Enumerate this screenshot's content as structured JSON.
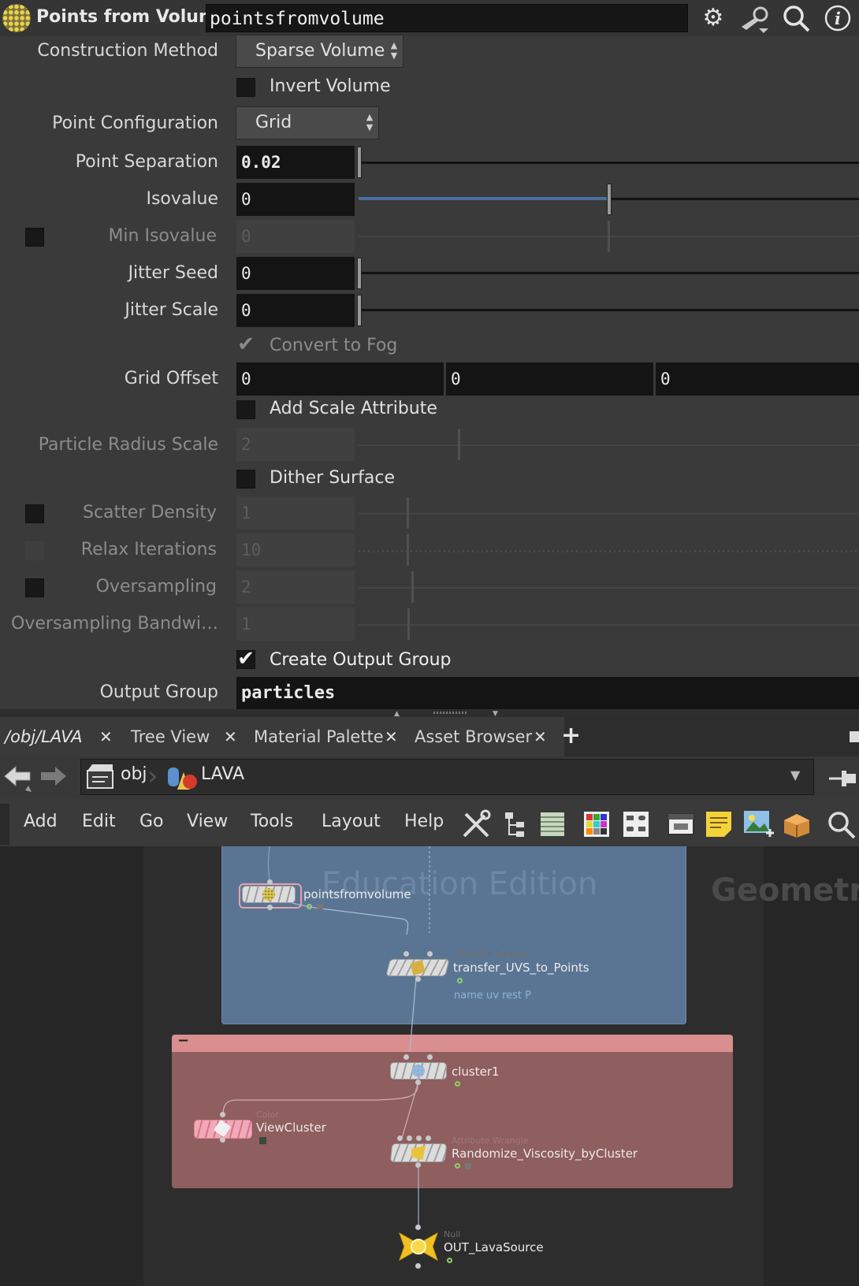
{
  "header": {
    "node_type_title": "Points from Volume",
    "node_name": "pointsfromvolume"
  },
  "params": {
    "construction_method": {
      "label": "Construction Method",
      "value": "Sparse Volume"
    },
    "invert_volume": {
      "label": "Invert Volume",
      "checked": false
    },
    "point_configuration": {
      "label": "Point Configuration",
      "value": "Grid"
    },
    "point_separation": {
      "label": "Point Separation",
      "value": "0.02"
    },
    "isovalue": {
      "label": "Isovalue",
      "value": "0"
    },
    "min_isovalue": {
      "label": "Min Isovalue",
      "value": "0"
    },
    "jitter_seed": {
      "label": "Jitter Seed",
      "value": "0"
    },
    "jitter_scale": {
      "label": "Jitter Scale",
      "value": "0"
    },
    "convert_to_fog": {
      "label": "Convert to Fog",
      "checked": true
    },
    "grid_offset": {
      "label": "Grid Offset",
      "x": "0",
      "y": "0",
      "z": "0"
    },
    "add_scale_attribute": {
      "label": "Add Scale Attribute",
      "checked": false
    },
    "particle_radius_scale": {
      "label": "Particle Radius Scale",
      "value": "2"
    },
    "dither_surface": {
      "label": "Dither Surface",
      "checked": false
    },
    "scatter_density": {
      "label": "Scatter Density",
      "value": "1"
    },
    "relax_iterations": {
      "label": "Relax Iterations",
      "value": "10"
    },
    "oversampling": {
      "label": "Oversampling",
      "value": "2"
    },
    "oversampling_bandwidth": {
      "label": "Oversampling Bandwi…",
      "value": "1"
    },
    "create_output_group": {
      "label": "Create Output Group",
      "checked": true
    },
    "output_group": {
      "label": "Output Group",
      "value": "particles"
    }
  },
  "tabs": [
    {
      "label": "/obj/LAVA",
      "active": true
    },
    {
      "label": "Tree View"
    },
    {
      "label": "Material Palette"
    },
    {
      "label": "Asset Browser"
    }
  ],
  "path": {
    "segments": [
      "obj",
      "LAVA"
    ]
  },
  "menu": [
    "Add",
    "Edit",
    "Go",
    "View",
    "Tools",
    "Layout",
    "Help"
  ],
  "network": {
    "watermark": "Education Edition",
    "context_label": "Geometr",
    "nodes": {
      "pointsfromvolume": {
        "name": "pointsfromvolume"
      },
      "transfer": {
        "type": "Attribute Transfer",
        "name": "transfer_UVS_to_Points",
        "note": "name uv rest P"
      },
      "cluster": {
        "name": "cluster1"
      },
      "viewcluster": {
        "type": "Color",
        "name": "ViewCluster"
      },
      "randomize": {
        "type": "Attribute Wrangle",
        "name": "Randomize_Viscosity_byCluster"
      },
      "out": {
        "type": "Null",
        "name": "OUT_LavaSource"
      }
    },
    "network_box_minimize": "−"
  },
  "colors": {
    "network_box_blue": "#5a7594",
    "network_box_red": "#8f5e5e",
    "network_box_red_header": "#d98f8f",
    "isovalue_slider_fill": "#4a6fa0",
    "null_node": "#f0c020"
  },
  "icons": [
    "gear-icon",
    "wrench-icon",
    "search-icon",
    "info-icon",
    "back-arrow-icon",
    "forward-arrow-icon",
    "add-tab-icon",
    "pin-icon"
  ]
}
